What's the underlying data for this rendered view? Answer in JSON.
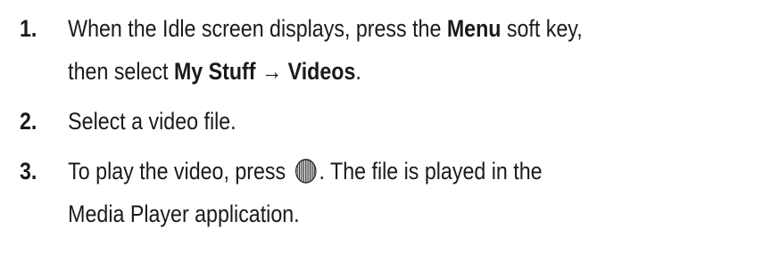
{
  "steps": [
    {
      "number": "1.",
      "line1_a": "When the Idle screen displays, press the ",
      "line1_bold": "Menu",
      "line1_b": " soft key,",
      "line2_a": "then select ",
      "line2_bold1": "My Stuff",
      "arrow": " → ",
      "line2_bold2": "Videos",
      "line2_b": "."
    },
    {
      "number": "2.",
      "text": "Select a video file."
    },
    {
      "number": "3.",
      "line1_a": "To play the video, press ",
      "icon": "ok-key-icon",
      "line1_b": ". The file is played in the",
      "line2": "Media Player application."
    }
  ]
}
